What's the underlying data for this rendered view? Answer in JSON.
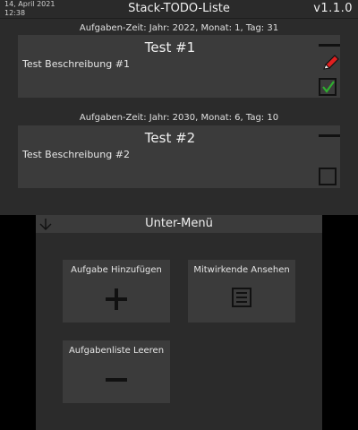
{
  "status_bar": {
    "date": "14, April 2021",
    "time": "12:38",
    "title": "Stack-TODO-Liste",
    "version": "v1.1.0"
  },
  "tasks": [
    {
      "deadline": "Aufgaben-Zeit: Jahr: 2022, Monat: 1, Tag: 31",
      "title": "Test #1",
      "description": "Test Beschreibung #1",
      "completed": true,
      "editable": true
    },
    {
      "deadline": "Aufgaben-Zeit: Jahr: 2030, Monat: 6, Tag: 10",
      "title": "Test #2",
      "description": "Test Beschreibung #2",
      "completed": false,
      "editable": false
    }
  ],
  "submenu": {
    "title": "Unter-Menü",
    "buttons": {
      "add_task": {
        "label": "Aufgabe Hinzufügen",
        "icon": "plus-icon"
      },
      "view_contributors": {
        "label": "Mitwirkende Ansehen",
        "icon": "list-icon"
      },
      "clear_list": {
        "label": "Aufgabenliste Leeren",
        "icon": "minus-icon"
      }
    }
  },
  "colors": {
    "background": "#2b2b2b",
    "card": "#3b3b3b",
    "check": "#2fae2f",
    "pencil": "#e02020"
  }
}
